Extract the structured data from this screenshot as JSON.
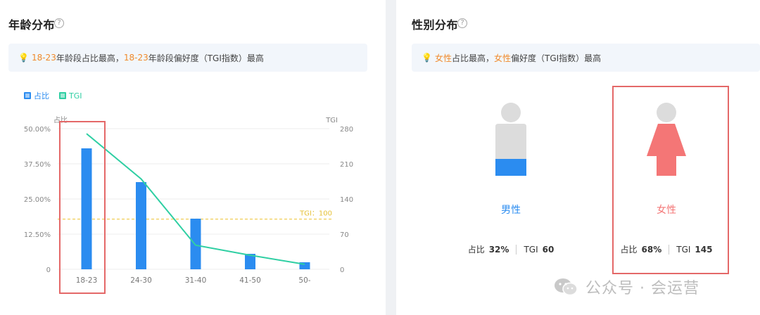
{
  "age_panel": {
    "title": "年龄分布",
    "help_glyph": "?",
    "tip": {
      "bulb": "💡",
      "seg1": "18-23",
      "seg2": "年龄段占比最高，",
      "seg3": "18-23",
      "seg4": "年龄段偏好度（TGI指数）最高"
    },
    "legend": {
      "share": "占比",
      "tgi": "TGI"
    }
  },
  "gender_panel": {
    "title": "性别分布",
    "help_glyph": "?",
    "tip": {
      "bulb": "💡",
      "seg1": "女性",
      "seg2": "占比最高，",
      "seg3": "女性",
      "seg4": "偏好度（TGI指数）最高"
    },
    "male": {
      "name": "男性",
      "share_label": "占比",
      "share_value": "32%",
      "tgi_label": "TGI",
      "tgi_value": "60",
      "share_fraction": 0.32
    },
    "female": {
      "name": "女性",
      "share_label": "占比",
      "share_value": "68%",
      "tgi_label": "TGI",
      "tgi_value": "145",
      "share_fraction": 0.68
    }
  },
  "colors": {
    "bar": "#2b8cf0",
    "tgi_line": "#2fcfa3",
    "reference": "#f2d36b",
    "male": "#2b8cf0",
    "female": "#f47676",
    "figure_gray": "#dcdcdc",
    "highlight": "#f08a2c",
    "box": "#e46868"
  },
  "watermark": {
    "text": "公众号 · 会运营"
  },
  "chart_data": {
    "type": "bar",
    "categories": [
      "18-23",
      "24-30",
      "31-40",
      "41-50",
      "50-"
    ],
    "series": [
      {
        "name": "占比",
        "axis": "left",
        "values": [
          43.0,
          31.0,
          18.0,
          5.5,
          2.5
        ],
        "unit": "%"
      },
      {
        "name": "TGI",
        "axis": "right",
        "type": "line",
        "values": [
          270,
          180,
          48,
          28,
          10
        ]
      }
    ],
    "left_axis": {
      "label": "占比",
      "ticks": [
        "0",
        "12.50%",
        "25.00%",
        "37.50%",
        "50.00%"
      ],
      "range": [
        0,
        50
      ]
    },
    "right_axis": {
      "label": "TGI",
      "ticks": [
        "0",
        "70",
        "140",
        "210",
        "280"
      ],
      "range": [
        0,
        280
      ]
    },
    "reference_line": {
      "label": "TGI：100",
      "value": 100,
      "axis": "right"
    },
    "legend": "top-left",
    "grid": true
  }
}
